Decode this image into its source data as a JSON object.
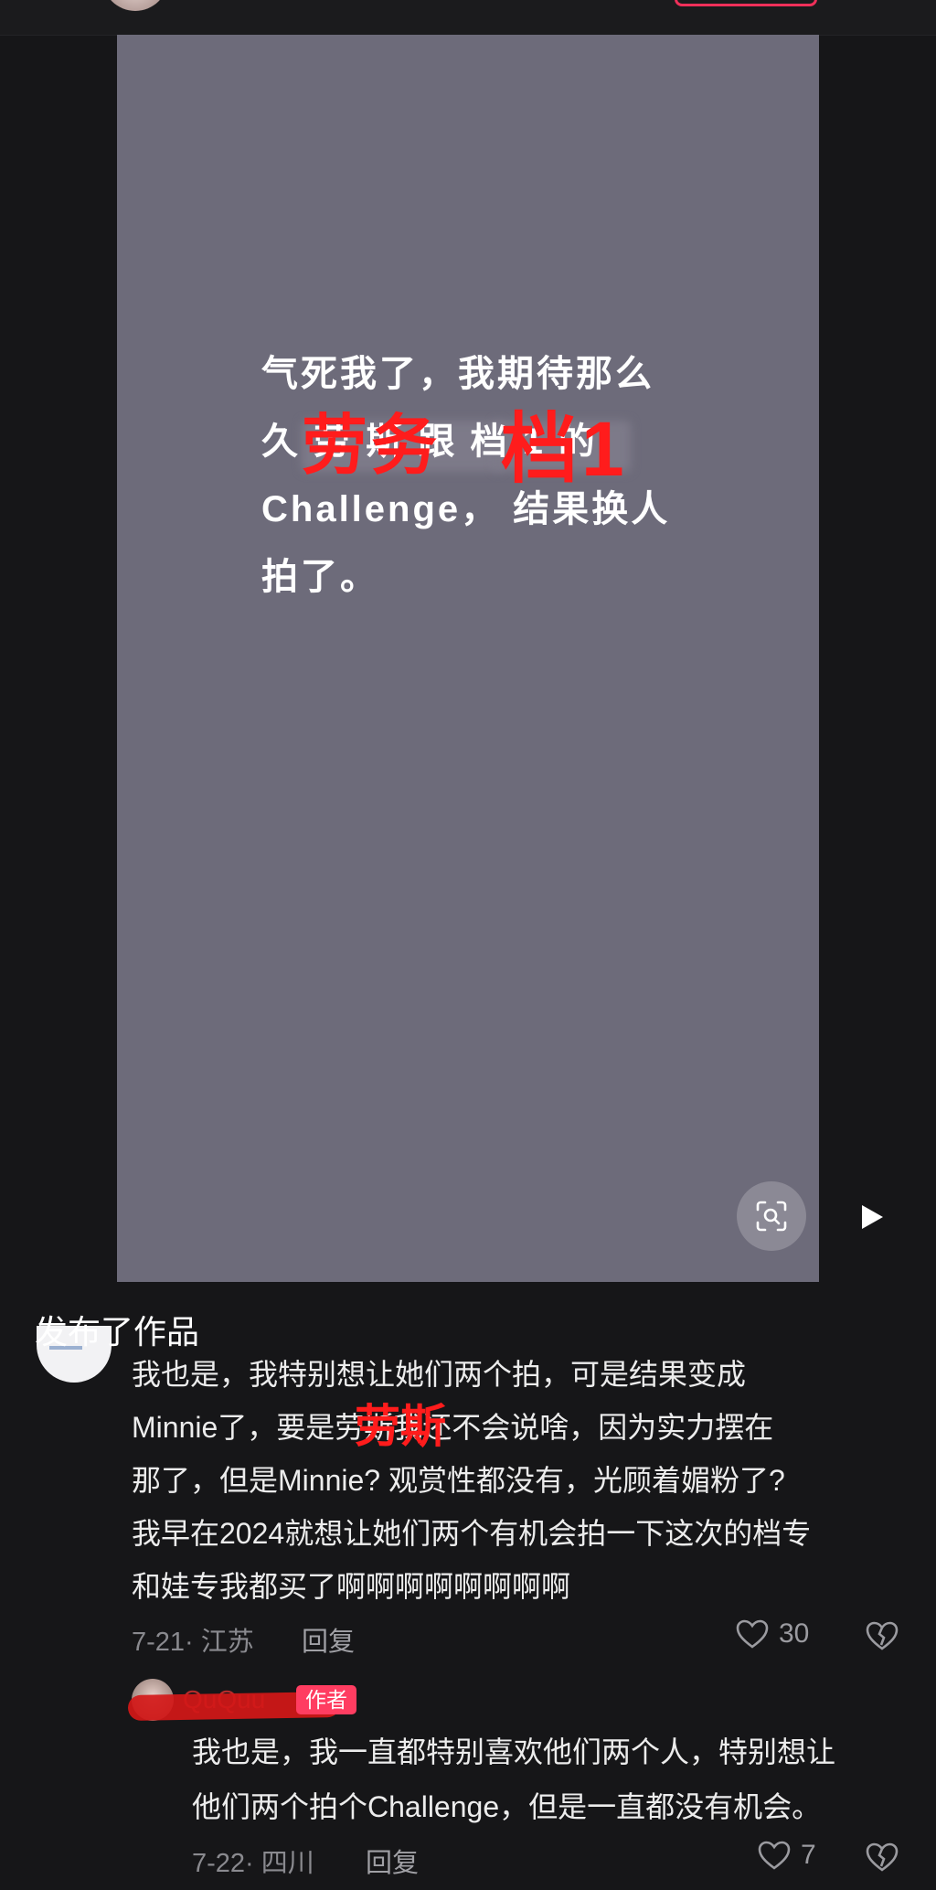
{
  "video": {
    "caption_lines": [
      "气死我了，我期待那么",
      "久 劳 斯 跟 档 1 的",
      "Challenge， 结果换人",
      "拍了。"
    ],
    "watermark_left": "劳务",
    "watermark_right": "档1"
  },
  "comment": {
    "published_label": "发布了作品",
    "watermark": "劳斯",
    "lines": [
      "我也是，我特别想让她们两个拍，可是结果变成",
      "Minnie了，要是劳斯我还不会说啥，因为实力摆在",
      "那了，但是Minnie? 观赏性都没有，光顾着媚粉了?",
      "我早在2024就想让她们两个有机会拍一下这次的档专",
      "和娃专我都买了啊啊啊啊啊啊啊啊"
    ],
    "date_location": "7-21· 江苏",
    "reply_label": "回复",
    "likes": "30"
  },
  "reply": {
    "username": "QuQuu",
    "author_badge": "作者",
    "lines": [
      "我也是，我一直都特别喜欢他们两个人，特别想让",
      "他们两个拍个Challenge，但是一直都没有机会。"
    ],
    "date_location": "7-22· 四川",
    "reply_label": "回复",
    "likes": "7"
  }
}
